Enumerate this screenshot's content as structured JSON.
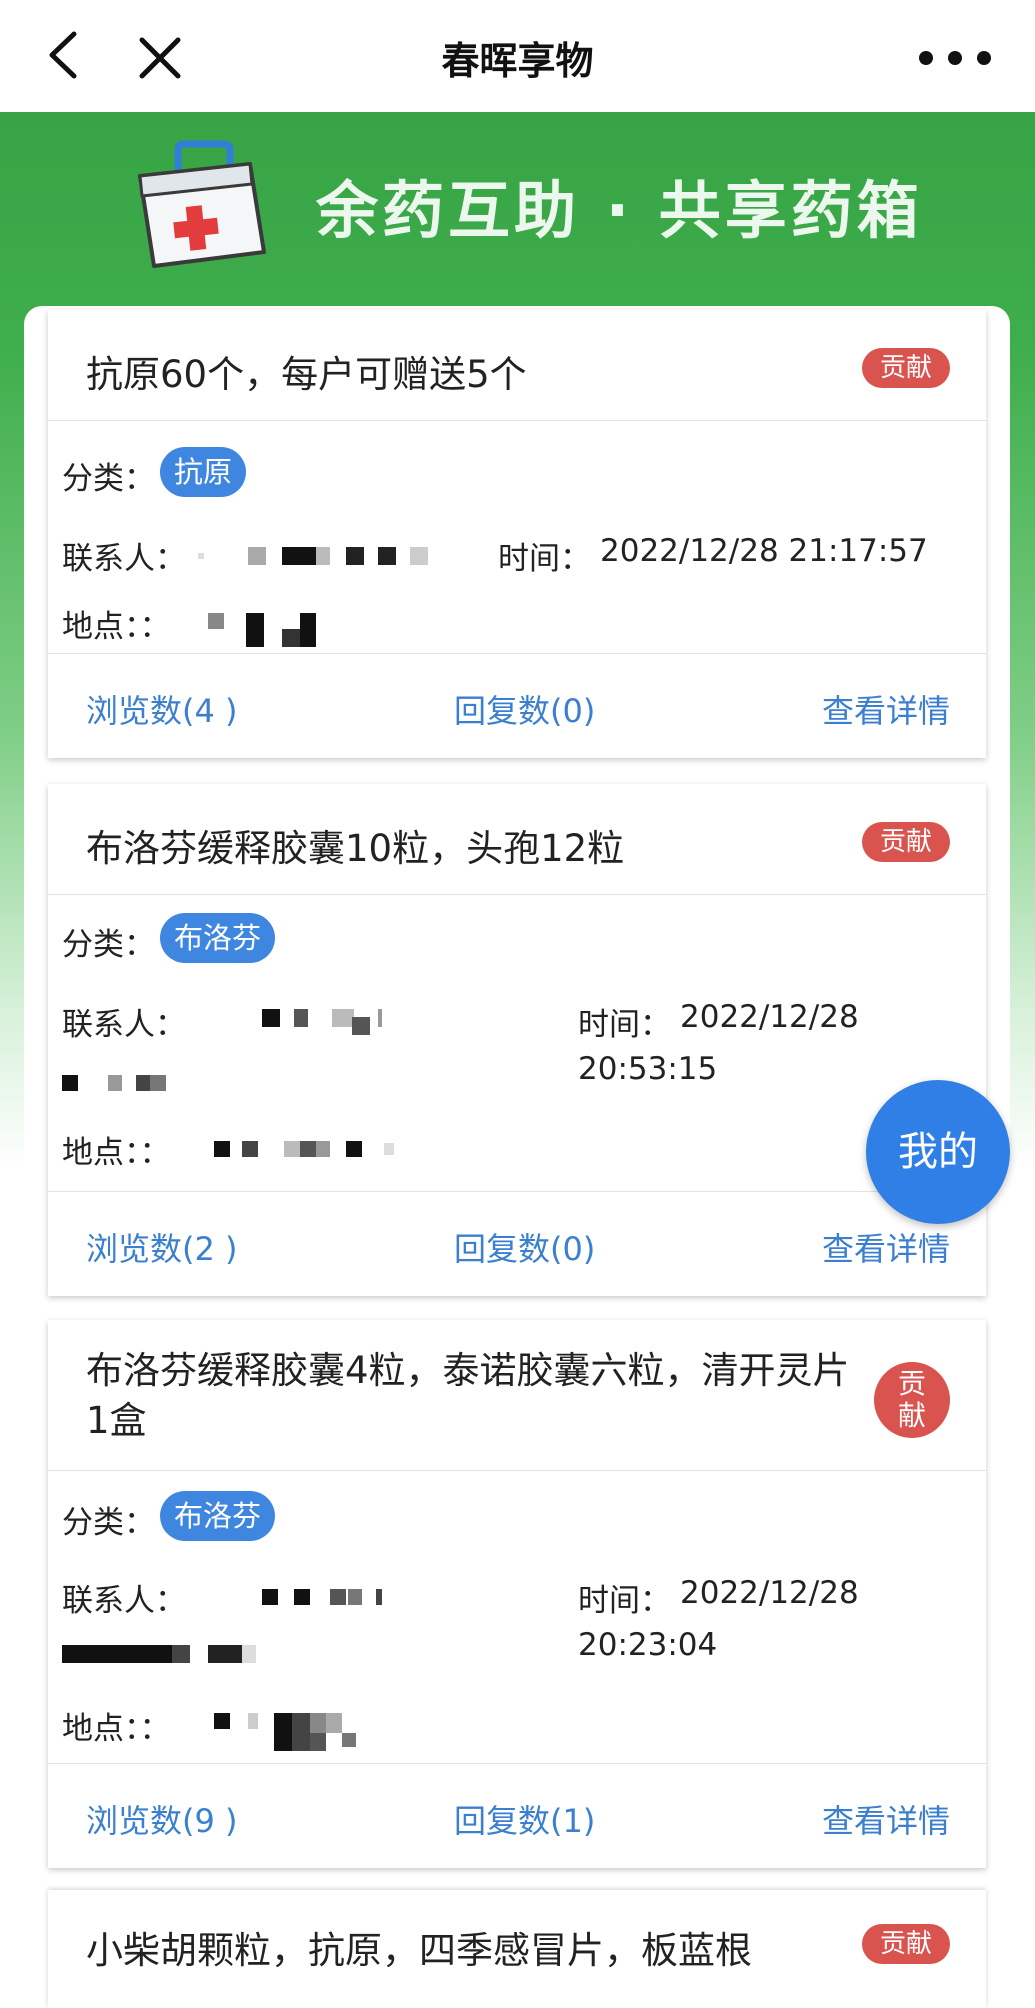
{
  "header": {
    "title": "春晖享物"
  },
  "banner": {
    "slogan": "余药互助 · 共享药箱"
  },
  "labels": {
    "category": "分类：",
    "contact": "联系人：",
    "time": "时间：",
    "location": "地点：："
  },
  "posts": [
    {
      "title": "抗原60个，每户可赠送5个",
      "tag": "贡献",
      "category": "抗原",
      "time": "2022/12/28 21:17:57",
      "views": "浏览数(4 )",
      "replies": "回复数(0)",
      "details": "查看详情"
    },
    {
      "title": "布洛芬缓释胶囊10粒，头孢12粒",
      "tag": "贡献",
      "category": "布洛芬",
      "time_date": "2022/12/28",
      "time_clock": "20:53:15",
      "views": "浏览数(2 )",
      "replies": "回复数(0)",
      "details": "查看详情"
    },
    {
      "title": "布洛芬缓释胶囊4粒，泰诺胶囊六粒，清开灵片1盒",
      "tag_line1": "贡",
      "tag_line2": "献",
      "category": "布洛芬",
      "time_date": "2022/12/28",
      "time_clock": "20:23:04",
      "views": "浏览数(9 )",
      "replies": "回复数(1)",
      "details": "查看详情"
    },
    {
      "title": "小柴胡颗粒，抗原，四季感冒片，板蓝根",
      "tag": "贡献"
    }
  ],
  "fab": {
    "label": "我的"
  },
  "colors": {
    "brand_green": "#3fae4c",
    "tag_red": "#d9534f",
    "category_blue": "#3f86e0",
    "link_blue": "#3a7fd0",
    "fab_blue": "#2f7fe6"
  }
}
